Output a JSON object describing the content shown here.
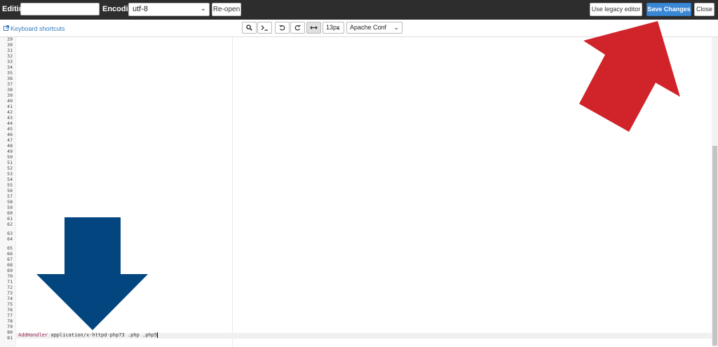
{
  "header": {
    "editing_label": "Editing:",
    "editing_value": "",
    "encoding_label": "Encoding:",
    "encoding_value": "utf-8",
    "reopen_label": "Re-open",
    "legacy_label": "Use legacy editor",
    "save_label": "Save Changes",
    "close_label": "Close"
  },
  "toolbar": {
    "shortcuts_label": "Keyboard shortcuts",
    "font_size": "13px",
    "mode": "Apache Conf",
    "icons": [
      "search-icon",
      "terminal-icon",
      "undo-icon",
      "redo-icon",
      "wrap-icon"
    ]
  },
  "editor": {
    "line_numbers": [
      "29",
      "30",
      "31",
      "32",
      "33",
      "34",
      "35",
      "36",
      "37",
      "38",
      "39",
      "40",
      "41",
      "42",
      "43",
      "44",
      "45",
      "46",
      "47",
      "48",
      "49",
      "50",
      "51",
      "52",
      "53",
      "54",
      "55",
      "56",
      "57",
      "58",
      "59",
      "60",
      "61",
      "62",
      "63",
      "64",
      "65",
      "66",
      "67",
      "68",
      "69",
      "70",
      "71",
      "72",
      "73",
      "74",
      "75",
      "76",
      "77",
      "78",
      "79",
      "80",
      "81"
    ],
    "active_line_keyword": "AddHandler",
    "active_line_rest": " application/x-httpd-php73 .php .php5"
  },
  "colors": {
    "topbar": "#2d2d2d",
    "save_button": "#3a87d4",
    "red_arrow": "#d1232a",
    "blue_arrow": "#02457f"
  }
}
